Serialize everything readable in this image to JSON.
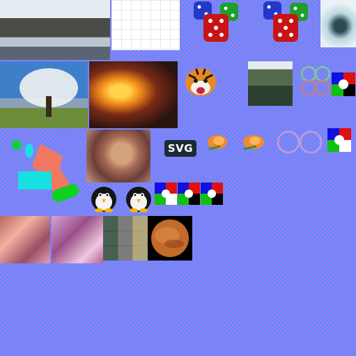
{
  "badge": {
    "svg_label": "SVG"
  },
  "colors": {
    "checker_a": "#9a7cf0",
    "checker_b": "#5b8cff",
    "accent_red": "#e01010",
    "accent_green": "#10c010",
    "accent_blue": "#1010e0",
    "accent_cyan": "#18e0e0",
    "accent_salmon": "#f07860"
  },
  "icons": [
    "dice-icon",
    "tiger-icon",
    "penguin-icon",
    "rose-icon",
    "rgb-quadrant-icon",
    "glass-ring-icon",
    "color-shapes-icon"
  ]
}
